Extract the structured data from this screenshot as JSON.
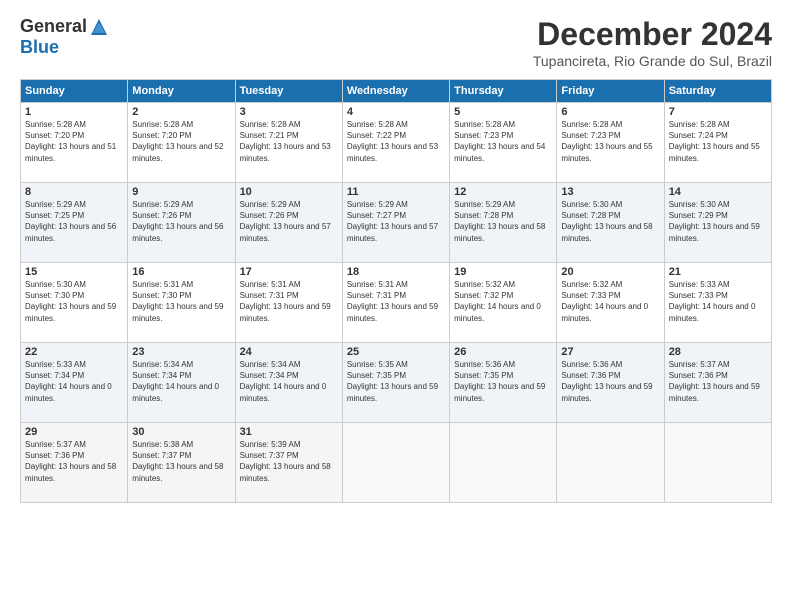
{
  "header": {
    "logo_general": "General",
    "logo_blue": "Blue",
    "month_title": "December 2024",
    "location": "Tupancireta, Rio Grande do Sul, Brazil"
  },
  "weekdays": [
    "Sunday",
    "Monday",
    "Tuesday",
    "Wednesday",
    "Thursday",
    "Friday",
    "Saturday"
  ],
  "weeks": [
    [
      {
        "day": "1",
        "sunrise": "5:28 AM",
        "sunset": "7:20 PM",
        "daylight": "13 hours and 51 minutes."
      },
      {
        "day": "2",
        "sunrise": "5:28 AM",
        "sunset": "7:20 PM",
        "daylight": "13 hours and 52 minutes."
      },
      {
        "day": "3",
        "sunrise": "5:28 AM",
        "sunset": "7:21 PM",
        "daylight": "13 hours and 53 minutes."
      },
      {
        "day": "4",
        "sunrise": "5:28 AM",
        "sunset": "7:22 PM",
        "daylight": "13 hours and 53 minutes."
      },
      {
        "day": "5",
        "sunrise": "5:28 AM",
        "sunset": "7:23 PM",
        "daylight": "13 hours and 54 minutes."
      },
      {
        "day": "6",
        "sunrise": "5:28 AM",
        "sunset": "7:23 PM",
        "daylight": "13 hours and 55 minutes."
      },
      {
        "day": "7",
        "sunrise": "5:28 AM",
        "sunset": "7:24 PM",
        "daylight": "13 hours and 55 minutes."
      }
    ],
    [
      {
        "day": "8",
        "sunrise": "5:29 AM",
        "sunset": "7:25 PM",
        "daylight": "13 hours and 56 minutes."
      },
      {
        "day": "9",
        "sunrise": "5:29 AM",
        "sunset": "7:26 PM",
        "daylight": "13 hours and 56 minutes."
      },
      {
        "day": "10",
        "sunrise": "5:29 AM",
        "sunset": "7:26 PM",
        "daylight": "13 hours and 57 minutes."
      },
      {
        "day": "11",
        "sunrise": "5:29 AM",
        "sunset": "7:27 PM",
        "daylight": "13 hours and 57 minutes."
      },
      {
        "day": "12",
        "sunrise": "5:29 AM",
        "sunset": "7:28 PM",
        "daylight": "13 hours and 58 minutes."
      },
      {
        "day": "13",
        "sunrise": "5:30 AM",
        "sunset": "7:28 PM",
        "daylight": "13 hours and 58 minutes."
      },
      {
        "day": "14",
        "sunrise": "5:30 AM",
        "sunset": "7:29 PM",
        "daylight": "13 hours and 59 minutes."
      }
    ],
    [
      {
        "day": "15",
        "sunrise": "5:30 AM",
        "sunset": "7:30 PM",
        "daylight": "13 hours and 59 minutes."
      },
      {
        "day": "16",
        "sunrise": "5:31 AM",
        "sunset": "7:30 PM",
        "daylight": "13 hours and 59 minutes."
      },
      {
        "day": "17",
        "sunrise": "5:31 AM",
        "sunset": "7:31 PM",
        "daylight": "13 hours and 59 minutes."
      },
      {
        "day": "18",
        "sunrise": "5:31 AM",
        "sunset": "7:31 PM",
        "daylight": "13 hours and 59 minutes."
      },
      {
        "day": "19",
        "sunrise": "5:32 AM",
        "sunset": "7:32 PM",
        "daylight": "14 hours and 0 minutes."
      },
      {
        "day": "20",
        "sunrise": "5:32 AM",
        "sunset": "7:33 PM",
        "daylight": "14 hours and 0 minutes."
      },
      {
        "day": "21",
        "sunrise": "5:33 AM",
        "sunset": "7:33 PM",
        "daylight": "14 hours and 0 minutes."
      }
    ],
    [
      {
        "day": "22",
        "sunrise": "5:33 AM",
        "sunset": "7:34 PM",
        "daylight": "14 hours and 0 minutes."
      },
      {
        "day": "23",
        "sunrise": "5:34 AM",
        "sunset": "7:34 PM",
        "daylight": "14 hours and 0 minutes."
      },
      {
        "day": "24",
        "sunrise": "5:34 AM",
        "sunset": "7:34 PM",
        "daylight": "14 hours and 0 minutes."
      },
      {
        "day": "25",
        "sunrise": "5:35 AM",
        "sunset": "7:35 PM",
        "daylight": "13 hours and 59 minutes."
      },
      {
        "day": "26",
        "sunrise": "5:36 AM",
        "sunset": "7:35 PM",
        "daylight": "13 hours and 59 minutes."
      },
      {
        "day": "27",
        "sunrise": "5:36 AM",
        "sunset": "7:36 PM",
        "daylight": "13 hours and 59 minutes."
      },
      {
        "day": "28",
        "sunrise": "5:37 AM",
        "sunset": "7:36 PM",
        "daylight": "13 hours and 59 minutes."
      }
    ],
    [
      {
        "day": "29",
        "sunrise": "5:37 AM",
        "sunset": "7:36 PM",
        "daylight": "13 hours and 58 minutes."
      },
      {
        "day": "30",
        "sunrise": "5:38 AM",
        "sunset": "7:37 PM",
        "daylight": "13 hours and 58 minutes."
      },
      {
        "day": "31",
        "sunrise": "5:39 AM",
        "sunset": "7:37 PM",
        "daylight": "13 hours and 58 minutes."
      },
      null,
      null,
      null,
      null
    ]
  ]
}
